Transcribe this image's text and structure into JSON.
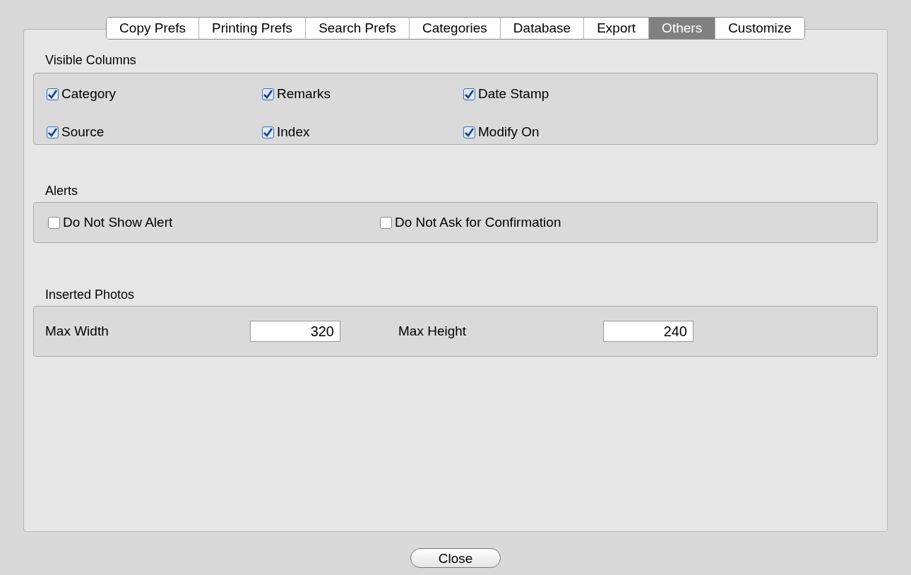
{
  "tabs": [
    {
      "label": "Copy Prefs",
      "selected": false
    },
    {
      "label": "Printing Prefs",
      "selected": false
    },
    {
      "label": "Search Prefs",
      "selected": false
    },
    {
      "label": "Categories",
      "selected": false
    },
    {
      "label": "Database",
      "selected": false
    },
    {
      "label": "Export",
      "selected": false
    },
    {
      "label": "Others",
      "selected": true
    },
    {
      "label": "Customize",
      "selected": false
    }
  ],
  "visible_columns": {
    "title": "Visible Columns",
    "items": [
      {
        "label": "Category",
        "checked": true
      },
      {
        "label": "Remarks",
        "checked": true
      },
      {
        "label": "Date Stamp",
        "checked": true
      },
      {
        "label": "Source",
        "checked": true
      },
      {
        "label": "Index",
        "checked": true
      },
      {
        "label": "Modify On",
        "checked": true
      }
    ]
  },
  "alerts": {
    "title": "Alerts",
    "items": [
      {
        "label": "Do Not Show Alert",
        "checked": false
      },
      {
        "label": "Do Not Ask for Confirmation",
        "checked": false
      }
    ]
  },
  "inserted_photos": {
    "title": "Inserted Photos",
    "fields": [
      {
        "label": "Max Width",
        "value": "320"
      },
      {
        "label": "Max Height",
        "value": "240"
      }
    ]
  },
  "close_button": "Close"
}
